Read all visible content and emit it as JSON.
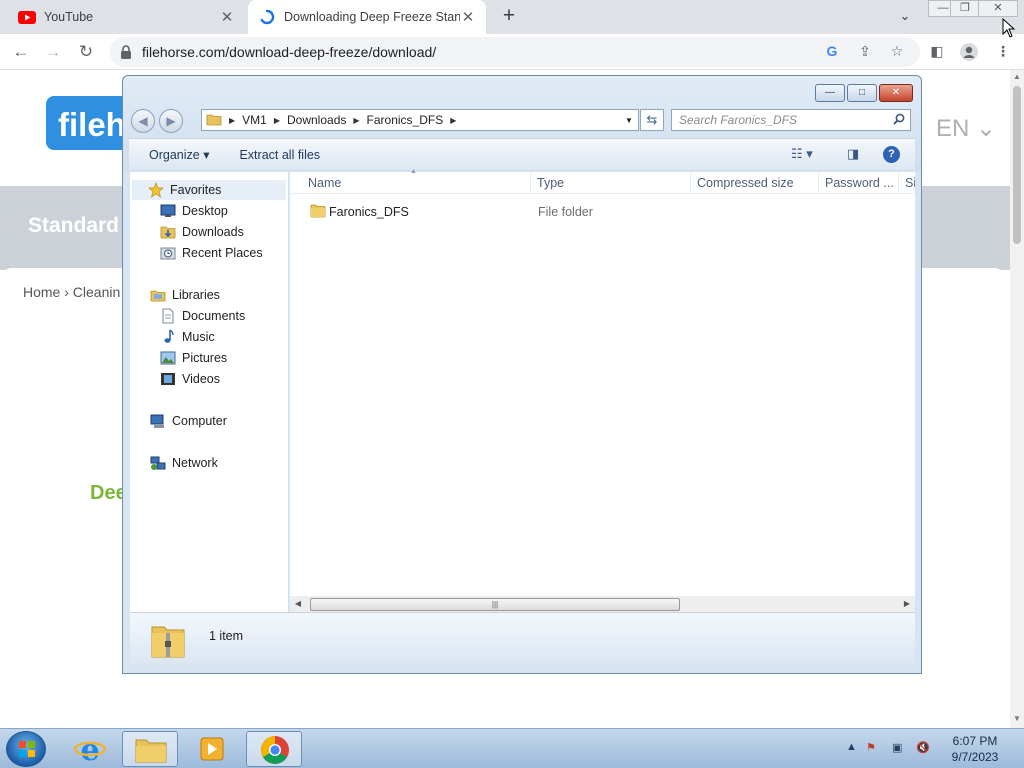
{
  "browser": {
    "tabs": [
      {
        "title": "YouTube",
        "close": "✕"
      },
      {
        "title": "Downloading Deep Freeze Stand",
        "close": "✕"
      }
    ],
    "new_tab": "+",
    "tab_menu": "⌄",
    "url": "filehorse.com/download-deep-freeze/download/",
    "window_controls": {
      "minimize": "—",
      "restore": "❐",
      "close": "✕"
    }
  },
  "webpage": {
    "logo": "fileh",
    "language": "EN ⌄",
    "hero_text": "Standard",
    "breadcrumb": "Home › Cleanin",
    "heading": "Dee"
  },
  "explorer": {
    "caption_buttons": {
      "minimize": "—",
      "maximize": "□",
      "close": "✕"
    },
    "address": [
      "VM1",
      "Downloads",
      "Faronics_DFS"
    ],
    "search_placeholder": "Search Faronics_DFS",
    "commands": {
      "organize": "Organize ▾",
      "extract": "Extract all files"
    },
    "nav": {
      "favorites": "Favorites",
      "desktop": "Desktop",
      "downloads": "Downloads",
      "recent": "Recent Places",
      "libraries": "Libraries",
      "documents": "Documents",
      "music": "Music",
      "pictures": "Pictures",
      "videos": "Videos",
      "computer": "Computer",
      "network": "Network"
    },
    "columns": {
      "name": "Name",
      "type": "Type",
      "compressed": "Compressed size",
      "password": "Password ...",
      "size": "Si"
    },
    "rows": [
      {
        "name": "Faronics_DFS",
        "type": "File folder"
      }
    ],
    "status": "1 item"
  },
  "taskbar": {
    "time": "6:07 PM",
    "date": "9/7/2023"
  },
  "colors": {
    "chrome_tabstrip": "#dee1e6",
    "youtube_red": "#ff0000",
    "explorer_frame": "#d7e4f2",
    "folder_yellow": "#e8c25a",
    "accent_green": "#7ab83b",
    "taskbar": "#9cbadb"
  }
}
